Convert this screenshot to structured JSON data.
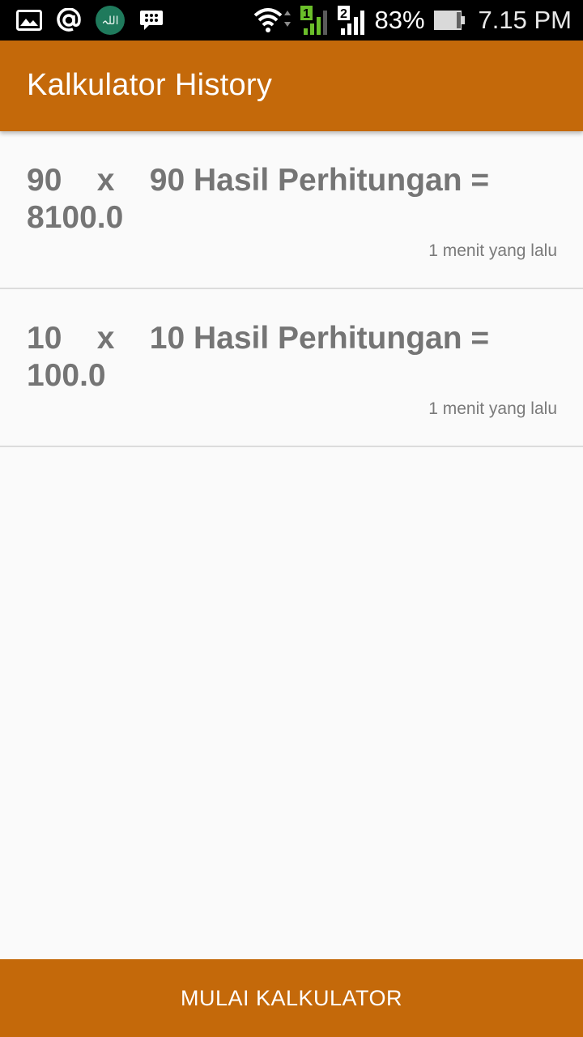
{
  "status_bar": {
    "battery_percent": "83%",
    "time": "7.15 PM",
    "sim1_label": "1",
    "sim2_label": "2",
    "icons": [
      "gallery-icon",
      "at-icon",
      "allah-app-icon",
      "bbm-icon",
      "wifi-icon",
      "signal-sim1-icon",
      "signal-sim2-icon",
      "battery-icon"
    ]
  },
  "app_bar": {
    "title": "Kalkulator History",
    "color": "#c4690a"
  },
  "history": [
    {
      "calculation": "90    x    90 Hasil Perhitungan = 8100.0",
      "time_ago": "1 menit yang lalu"
    },
    {
      "calculation": "10    x    10 Hasil Perhitungan = 100.0",
      "time_ago": "1 menit yang lalu"
    }
  ],
  "footer": {
    "button_label": "MULAI KALKULATOR"
  }
}
